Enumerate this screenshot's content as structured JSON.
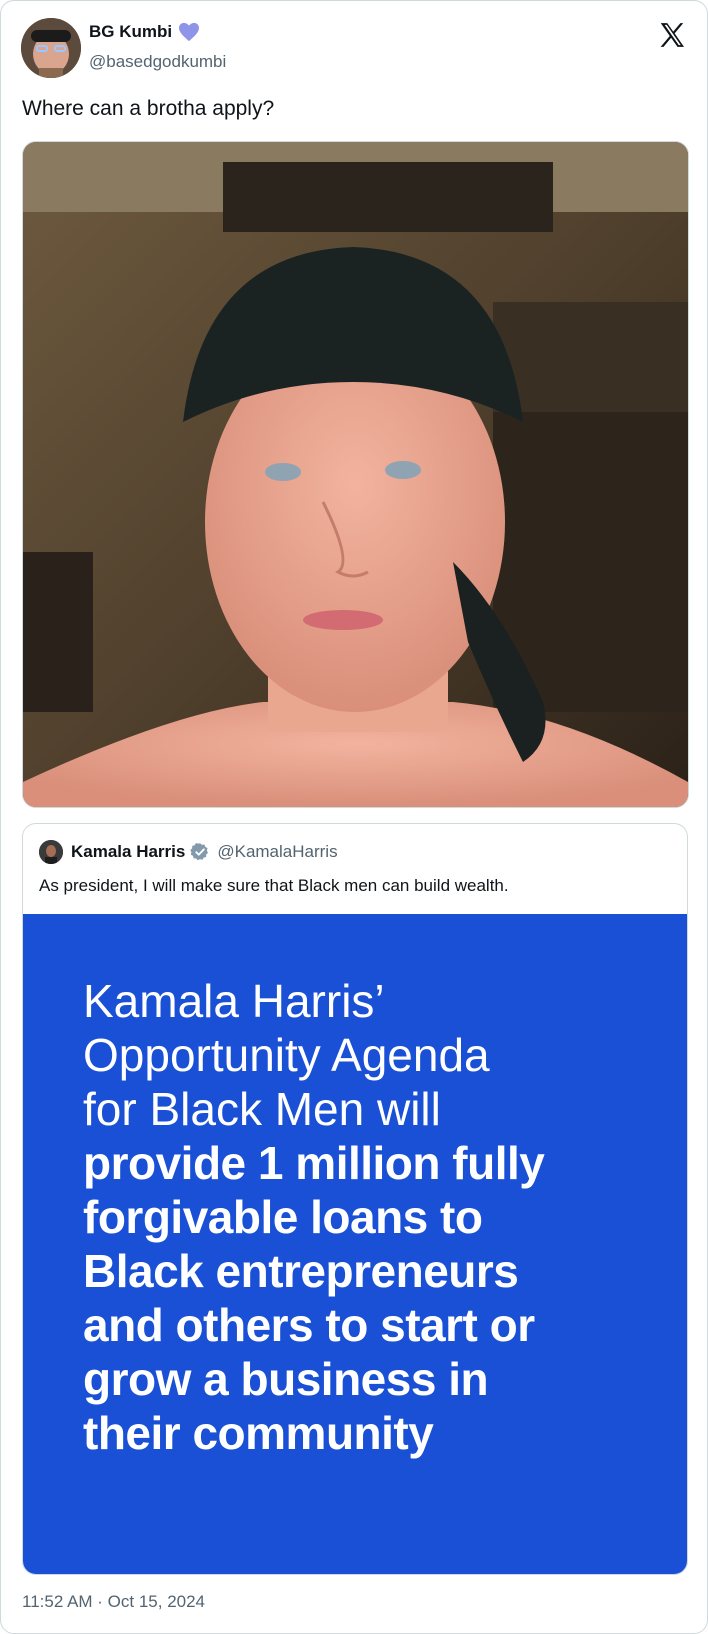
{
  "tweet": {
    "author_name": "BG Kumbi",
    "author_handle": "@basedgodkumbi",
    "text": "Where can a brotha apply?",
    "timestamp": "11:52 AM · Oct 15, 2024",
    "heart_color": "#8e94e8"
  },
  "quoted_tweet": {
    "author_name": "Kamala Harris",
    "author_handle": "@KamalaHarris",
    "text": "As president, I will make sure that Black men can build wealth.",
    "media_headline_light": [
      "Kamala Harris’",
      "Opportunity Agenda",
      "for Black Men will"
    ],
    "media_headline_bold": [
      "provide 1 million fully",
      "forgivable loans to",
      "Black entrepreneurs",
      "and others to start or",
      "grow a business in",
      "their community"
    ],
    "media_bg_color": "#1950d6"
  },
  "icons": {
    "platform_logo": "x-logo-icon",
    "verified": "verified-badge-icon",
    "heart": "heart-icon"
  }
}
